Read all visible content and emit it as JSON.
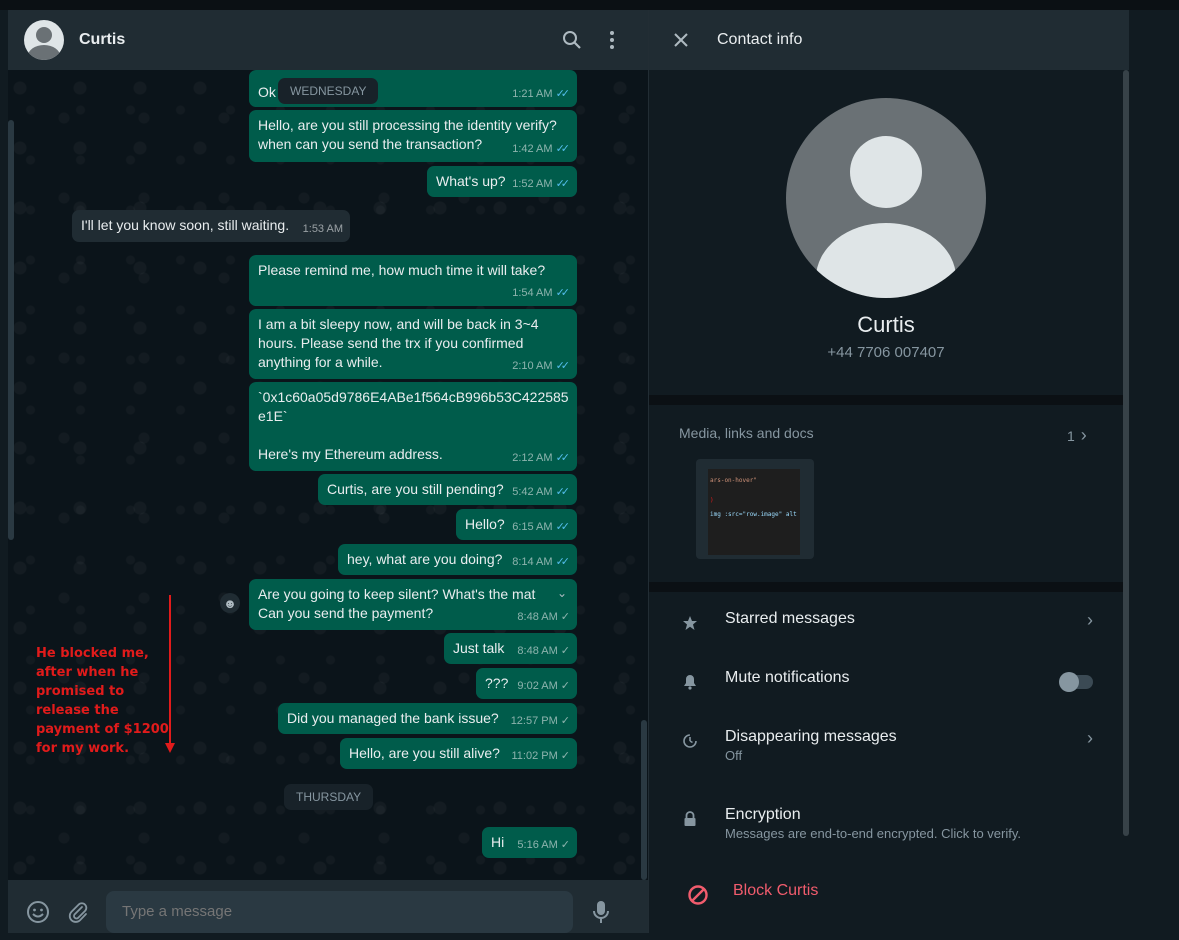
{
  "chat": {
    "contact_name": "Curtis",
    "composer_placeholder": "Type a message"
  },
  "day_chips": {
    "wednesday": "WEDNESDAY",
    "thursday": "THURSDAY"
  },
  "messages": [
    {
      "text": "Ok",
      "time": "1:21 AM",
      "status": "read"
    },
    {
      "text": "Hello, are you still processing the identity verify? when can you send the transaction?",
      "time": "1:42 AM",
      "status": "read"
    },
    {
      "text": "What's up?",
      "time": "1:52 AM",
      "status": "read"
    },
    {
      "text": "I'll let you know soon, still waiting.",
      "time": "1:53 AM",
      "status": "incoming"
    },
    {
      "text": "Please remind me, how much time it will take?",
      "time": "1:54 AM",
      "status": "read"
    },
    {
      "text": "I am a bit sleepy now, and will be back in 3~4 hours. Please send the trx if you confirmed anything for a while.",
      "time": "2:10 AM",
      "status": "read"
    },
    {
      "text_line1": "`0x1c60a05d9786E4ABe1f564cB996b53C422585e1E`",
      "text_line2": "Here's my Ethereum address.",
      "time": "2:12 AM",
      "status": "read"
    },
    {
      "text": "Curtis, are you still pending?",
      "time": "5:42 AM",
      "status": "read"
    },
    {
      "text": "Hello?",
      "time": "6:15 AM",
      "status": "read"
    },
    {
      "text": "hey, what are you doing?",
      "time": "8:14 AM",
      "status": "read"
    },
    {
      "text_line1": "Are you going to keep silent? What's the mat",
      "text_line2": "Can you send the payment?",
      "time": "8:48 AM",
      "status": "sent"
    },
    {
      "text": "Just talk",
      "time": "8:48 AM",
      "status": "sent"
    },
    {
      "text": "???",
      "time": "9:02 AM",
      "status": "sent"
    },
    {
      "text": "Did you managed the bank issue?",
      "time": "12:57 PM",
      "status": "sent"
    },
    {
      "text": "Hello, are you still alive?",
      "time": "11:02 PM",
      "status": "sent"
    },
    {
      "text": "Hi",
      "time": "5:16 AM",
      "status": "sent"
    }
  ],
  "annotation": {
    "text": "He blocked me, after when he promised to release the payment of $1200 for my work.",
    "color": "#e11b1b"
  },
  "contact_info": {
    "title": "Contact info",
    "name": "Curtis",
    "phone": "+44 7706 007407",
    "media_label": "Media, links and docs",
    "media_count": "1",
    "thumb_line1": "ars-on-hover\"",
    "thumb_line2": ")",
    "thumb_line3": "img :src=\"row.image\" alt",
    "starred": "Starred messages",
    "mute": "Mute notifications",
    "disappearing": "Disappearing messages",
    "disappearing_sub": "Off",
    "encryption": "Encryption",
    "encryption_sub": "Messages are end-to-end encrypted. Click to verify.",
    "block": "Block Curtis"
  },
  "colors": {
    "outgoing_bubble": "#005c4b",
    "incoming_bubble": "#202c33",
    "read_tick": "#53bdeb",
    "danger": "#f15c6d"
  }
}
